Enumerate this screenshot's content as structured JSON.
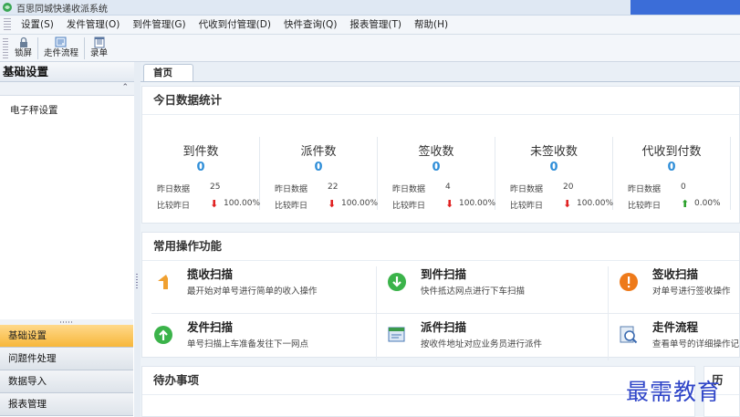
{
  "window": {
    "title": "百思同城快递收派系统"
  },
  "menu": [
    "设置(S)",
    "发件管理(O)",
    "到件管理(G)",
    "代收到付管理(D)",
    "快件查询(Q)",
    "报表管理(T)",
    "帮助(H)"
  ],
  "toolbar": [
    {
      "label": "锁屏",
      "icon": "lock-icon"
    },
    {
      "label": "走件流程",
      "icon": "flow-icon"
    },
    {
      "label": "录单",
      "icon": "form-icon"
    }
  ],
  "sidebar": {
    "title": "基础设置",
    "tree": [
      "电子秤设置"
    ],
    "nav": [
      {
        "label": "基础设置",
        "active": true
      },
      {
        "label": "问题件处理",
        "active": false
      },
      {
        "label": "数据导入",
        "active": false
      },
      {
        "label": "报表管理",
        "active": false
      }
    ]
  },
  "tabs": [
    {
      "label": "首页",
      "active": true
    }
  ],
  "stats": {
    "title": "今日数据统计",
    "yesterday_label": "昨日数据",
    "compare_label": "比较昨日",
    "items": [
      {
        "title": "到件数",
        "value": "0",
        "yesterday": "25",
        "trend": "down",
        "percent": "100.00%"
      },
      {
        "title": "派件数",
        "value": "0",
        "yesterday": "22",
        "trend": "down",
        "percent": "100.00%"
      },
      {
        "title": "签收数",
        "value": "0",
        "yesterday": "4",
        "trend": "down",
        "percent": "100.00%"
      },
      {
        "title": "未签收数",
        "value": "0",
        "yesterday": "20",
        "trend": "down",
        "percent": "100.00%"
      },
      {
        "title": "代收到付数",
        "value": "0",
        "yesterday": "0",
        "trend": "up",
        "percent": "0.00%"
      }
    ],
    "colors": {
      "down": "#e02020",
      "up": "#2aa02a",
      "value": "#2f8ed8"
    }
  },
  "ops": {
    "title": "常用操作功能",
    "items": [
      {
        "title": "揽收扫描",
        "desc": "最开始对单号进行简单的收入操作",
        "icon": "return-arrow-icon"
      },
      {
        "title": "到件扫描",
        "desc": "快件抵达网点进行下车扫描",
        "icon": "down-arrow-circle-icon"
      },
      {
        "title": "签收扫描",
        "desc": "对单号进行签收操作",
        "icon": "exclamation-circle-icon"
      },
      {
        "title": "发件扫描",
        "desc": "单号扫描上车准备发往下一网点",
        "icon": "up-arrow-circle-icon"
      },
      {
        "title": "派件扫描",
        "desc": "按收件地址对应业务员进行派件",
        "icon": "dispatch-icon"
      },
      {
        "title": "走件流程",
        "desc": "查看单号的详细操作记",
        "icon": "magnifier-icon"
      }
    ]
  },
  "todo": {
    "title": "待办事项"
  },
  "side_panel": {
    "title": "历"
  },
  "watermark": "最需教育"
}
